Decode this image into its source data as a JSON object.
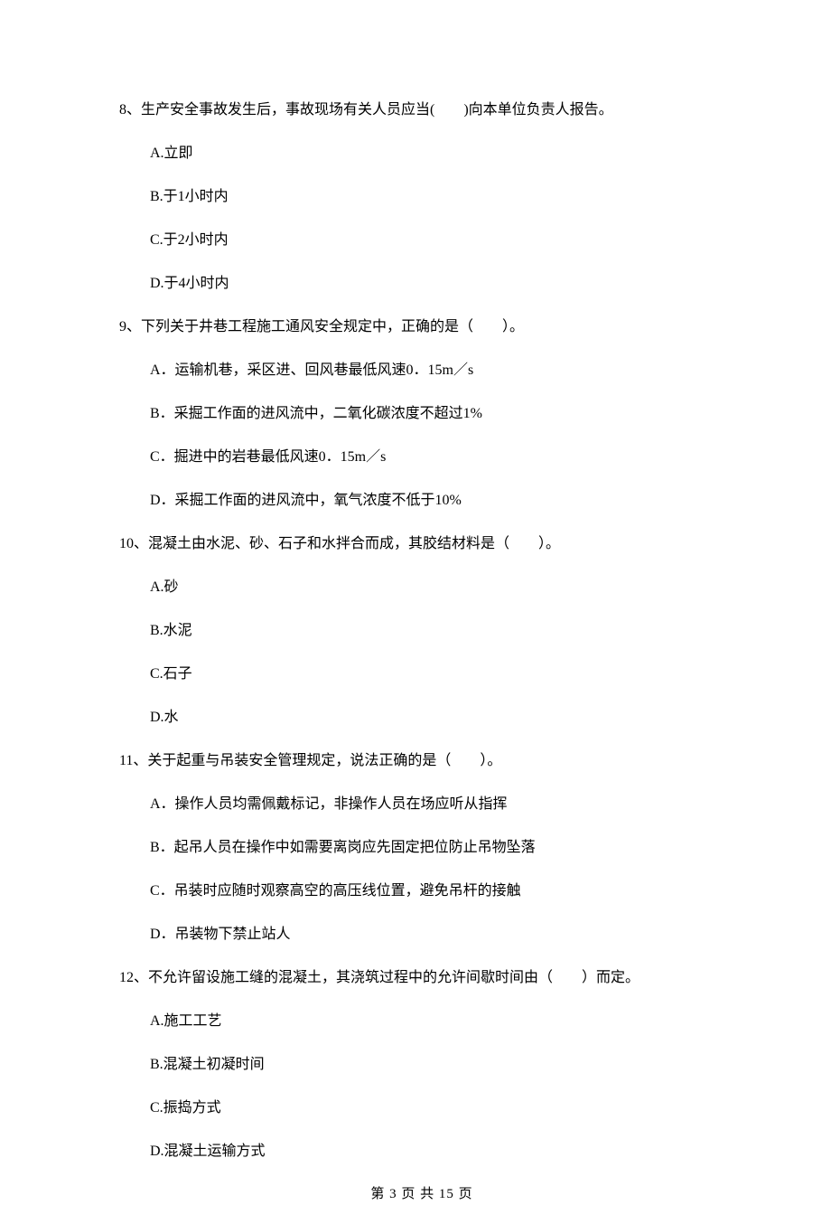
{
  "questions": [
    {
      "number": "8、",
      "text": "生产安全事故发生后，事故现场有关人员应当(　　)向本单位负责人报告。",
      "options": [
        {
          "label": "A.立即"
        },
        {
          "label": "B.于1小时内"
        },
        {
          "label": "C.于2小时内"
        },
        {
          "label": "D.于4小时内"
        }
      ]
    },
    {
      "number": "9、",
      "text": "下列关于井巷工程施工通风安全规定中，正确的是（　　）。",
      "options": [
        {
          "label": "A．运输机巷，采区进、回风巷最低风速0．15m／s"
        },
        {
          "label": "B．采掘工作面的进风流中，二氧化碳浓度不超过1%"
        },
        {
          "label": "C．掘进中的岩巷最低风速0．15m／s"
        },
        {
          "label": "D．采掘工作面的进风流中，氧气浓度不低于10%"
        }
      ]
    },
    {
      "number": "10、",
      "text": "混凝土由水泥、砂、石子和水拌合而成，其胶结材料是（　　）。",
      "options": [
        {
          "label": "A.砂"
        },
        {
          "label": "B.水泥"
        },
        {
          "label": "C.石子"
        },
        {
          "label": "D.水"
        }
      ]
    },
    {
      "number": "11、",
      "text": "关于起重与吊装安全管理规定，说法正确的是（　　）。",
      "options": [
        {
          "label": "A．操作人员均需佩戴标记，非操作人员在场应听从指挥"
        },
        {
          "label": "B．起吊人员在操作中如需要离岗应先固定把位防止吊物坠落"
        },
        {
          "label": "C．吊装时应随时观察高空的高压线位置，避免吊杆的接触"
        },
        {
          "label": "D．吊装物下禁止站人"
        }
      ]
    },
    {
      "number": "12、",
      "text": "不允许留设施工缝的混凝土，其浇筑过程中的允许间歇时间由（　　）而定。",
      "options": [
        {
          "label": "A.施工工艺"
        },
        {
          "label": "B.混凝土初凝时间"
        },
        {
          "label": "C.振捣方式"
        },
        {
          "label": "D.混凝土运输方式"
        }
      ]
    }
  ],
  "footer": "第 3 页 共 15 页"
}
